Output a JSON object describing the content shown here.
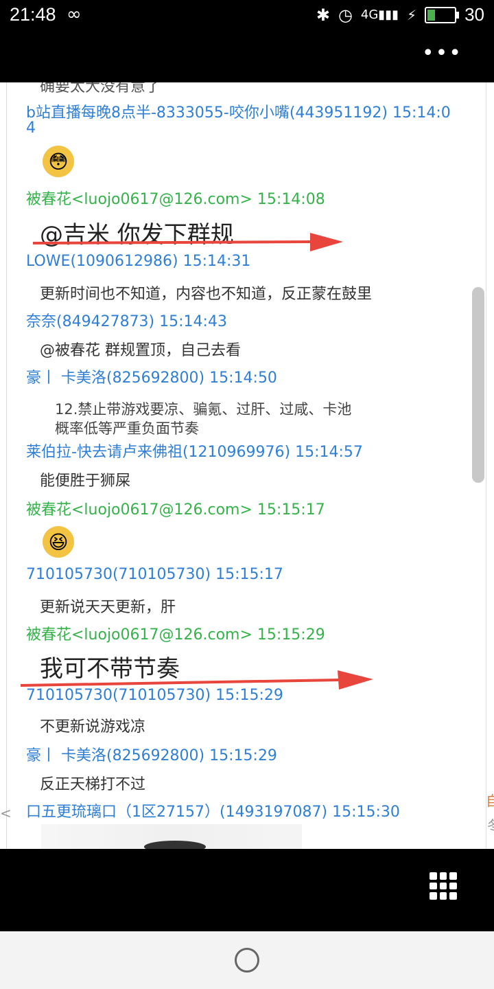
{
  "status": {
    "time": "21:48",
    "infinity_icon": "∞",
    "bluetooth_icon": "✱",
    "alarm_icon": "◷",
    "signal_icon": "4G▮▮▮",
    "bolt_icon": "⚡",
    "battery": "30",
    "battery_level": 0.3,
    "battery_color": "#4caf50"
  },
  "topbar": {
    "more_icon": "•••"
  },
  "chat": {
    "partial_top": "确要太大没有意了",
    "m1": {
      "header_line1": "b站直播每晚8点半-8333055-咬你小嘴(443951192) 15:14:0",
      "header_line2": "4",
      "emoji": "😳"
    },
    "m2": {
      "header": "被春花<luojo0617@126.com> 15:14:08",
      "text": "@吉米 你发下群规"
    },
    "m3": {
      "header": "LOWE(1090612986) 15:14:31",
      "text": "更新时间也不知道，内容也不知道，反正蒙在鼓里"
    },
    "m4": {
      "header": "奈奈(849427873) 15:14:43",
      "text": "@被春花 群规置顶，自己去看"
    },
    "m5": {
      "header": "豪丨 卡美洛(825692800) 15:14:50",
      "text_line1": "12.禁止带游戏要凉、骗氪、过肝、过咸、卡池",
      "text_line2": "概率低等严重负面节奏"
    },
    "m6": {
      "header": "莱伯拉-快去请卢来佛祖(1210969976) 15:14:57",
      "text": "能便胜于狮屎"
    },
    "m7": {
      "header": "被春花<luojo0617@126.com> 15:15:17",
      "emoji": "😆"
    },
    "m8": {
      "header": "710105730(710105730) 15:15:17",
      "text": "更新说天天更新，肝"
    },
    "m9": {
      "header": "被春花<luojo0617@126.com> 15:15:29",
      "text": "我可不带节奏"
    },
    "m10": {
      "header": "710105730(710105730) 15:15:29",
      "text": "不更新说游戏凉"
    },
    "m11": {
      "header": "豪丨 卡美洛(825692800) 15:15:29",
      "text": "反正天梯打不过"
    },
    "m12": {
      "header": "口五更琉璃口（1区27157）(1493197087) 15:15:30"
    },
    "edge_right1": "自",
    "edge_right2": "冬",
    "edge_left": "<",
    "arrow_color": "#e8453c"
  },
  "bottom": {
    "grid_icon": "apps-grid"
  }
}
